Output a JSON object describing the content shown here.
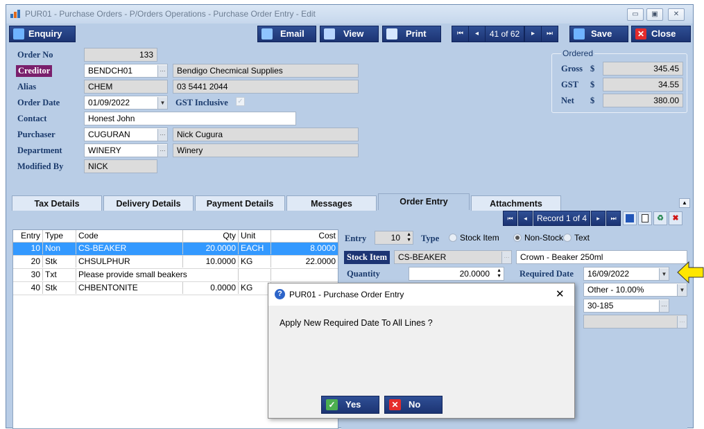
{
  "window": {
    "title": "PUR01 - Purchase Orders - P/Orders Operations - Purchase Order Entry - Edit"
  },
  "toolbar": {
    "enquiry": "Enquiry",
    "email": "Email",
    "view": "View",
    "print": "Print",
    "nav_first": "⏮",
    "nav_prev": "◂",
    "position": "41 of 62",
    "nav_next": "▸",
    "nav_last": "⏭",
    "save": "Save",
    "close": "Close"
  },
  "header": {
    "order_no_label": "Order No",
    "order_no": "133",
    "creditor_label": "Creditor",
    "creditor_code": "BENDCH01",
    "creditor_name": "Bendigo Checmical Supplies",
    "alias_label": "Alias",
    "alias": "CHEM",
    "phone": "03 5441 2044",
    "order_date_label": "Order Date",
    "order_date": "01/09/2022",
    "gst_inclusive_label": "GST Inclusive",
    "contact_label": "Contact",
    "contact": "Honest John",
    "purchaser_label": "Purchaser",
    "purchaser_code": "CUGURAN",
    "purchaser_name": "Nick Cugura",
    "department_label": "Department",
    "department_code": "WINERY",
    "department_name": "Winery",
    "modified_by_label": "Modified By",
    "modified_by": "NICK"
  },
  "ordered": {
    "group_label": "Ordered",
    "gross_label": "Gross",
    "gst_label": "GST",
    "net_label": "Net",
    "currency": "$",
    "gross": "345.45",
    "gst": "34.55",
    "net": "380.00"
  },
  "tabs": [
    "Tax Details",
    "Delivery Details",
    "Payment Details",
    "Messages",
    "Order Entry",
    "Attachments"
  ],
  "record_nav": {
    "position": "Record 1 of 4"
  },
  "grid": {
    "columns": [
      "Entry",
      "Type",
      "Code",
      "Qty",
      "Unit",
      "Cost"
    ],
    "rows": [
      {
        "entry": "10",
        "type": "Non",
        "code": "CS-BEAKER",
        "qty": "20.0000",
        "unit": "EACH",
        "cost": "8.0000"
      },
      {
        "entry": "20",
        "type": "Stk",
        "code": "CHSULPHUR",
        "qty": "10.0000",
        "unit": "KG",
        "cost": "22.0000"
      },
      {
        "entry": "30",
        "type": "Txt",
        "code": "Please provide small beakers",
        "qty": "",
        "unit": "",
        "cost": ""
      },
      {
        "entry": "40",
        "type": "Stk",
        "code": "CHBENTONITE",
        "qty": "0.0000",
        "unit": "KG",
        "cost": ""
      }
    ]
  },
  "entry_panel": {
    "entry_label": "Entry",
    "entry_value": "10",
    "type_label": "Type",
    "type_options": [
      "Stock Item",
      "Non-Stock",
      "Text"
    ],
    "type_selected": "Non-Stock",
    "stock_item_label": "Stock Item",
    "stock_item_code": "CS-BEAKER",
    "stock_item_desc": "Crown - Beaker 250ml",
    "quantity_label": "Quantity",
    "quantity": "20.0000",
    "required_date_label": "Required Date",
    "required_date": "16/09/2022",
    "tax_code": "Other - 10.00%",
    "account": "30-185"
  },
  "dialog": {
    "title": "PUR01 - Purchase Order Entry",
    "message": "Apply New Required Date To All Lines ?",
    "yes": "Yes",
    "no": "No",
    "close": "✕"
  },
  "colors": {
    "accent_arrow": "#ffe600",
    "selected_row": "#3399ff",
    "button_blue": "#1c3473"
  }
}
